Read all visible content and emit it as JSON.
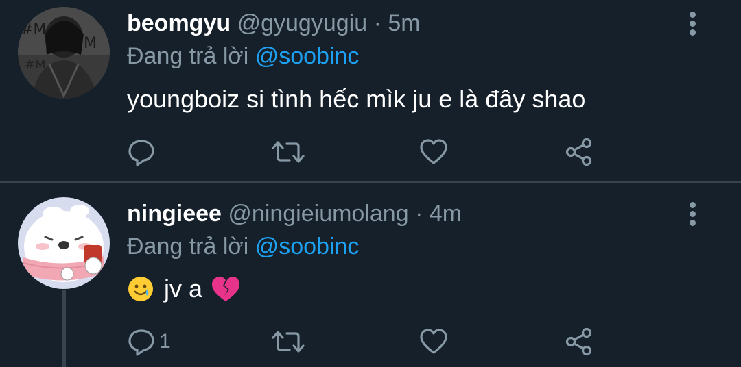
{
  "tweets": [
    {
      "display_name": "beomgyu",
      "handle": "@gyugyugiu",
      "separator": "·",
      "time": "5m",
      "reply_prefix": "Đang trả lời",
      "reply_mention": "@soobinc",
      "text": "youngboiz si tình hếc mìk ju e là đây shao",
      "reply_count": "",
      "icons": [
        "reply-icon",
        "retweet-icon",
        "like-icon",
        "share-icon",
        "more-icon"
      ]
    },
    {
      "display_name": "ningieee",
      "handle": "@ningieiumolang",
      "separator": "·",
      "time": "4m",
      "reply_prefix": "Đang trả lời",
      "reply_mention": "@soobinc",
      "text": "jv a",
      "reply_count": "1",
      "icons": [
        "reply-icon",
        "retweet-icon",
        "like-icon",
        "share-icon",
        "more-icon",
        "smiling-face-with-tear-emoji",
        "broken-heart-emoji"
      ]
    }
  ],
  "colors": {
    "background": "#15202b",
    "divider": "#38444d",
    "primary_text": "#ffffff",
    "secondary_text": "#8899a6",
    "link": "#1da1f2"
  }
}
